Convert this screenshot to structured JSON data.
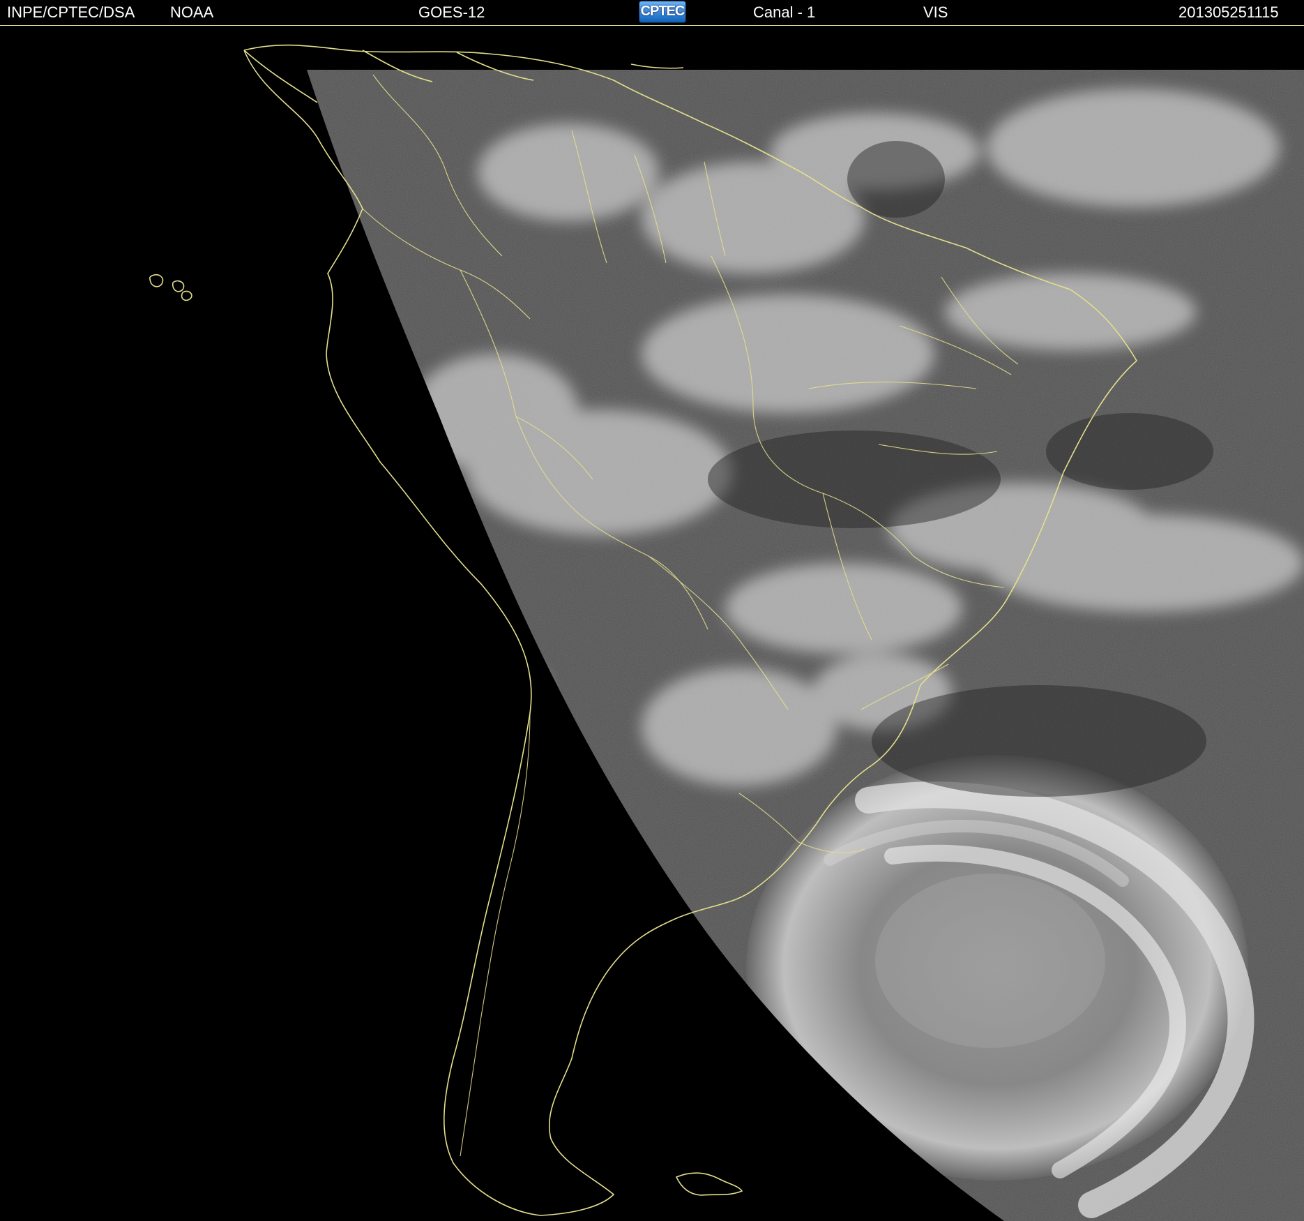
{
  "header": {
    "institution": "INPE/CPTEC/DSA",
    "agency": "NOAA",
    "satellite": "GOES-12",
    "logo_text": "CPTEC",
    "channel": "Canal - 1",
    "band": "VIS",
    "timestamp": "201305251115"
  },
  "colors": {
    "background": "#000000",
    "coastline": "#e4df8c",
    "cloud": "#d7d7d7",
    "ocean_image": "#505050"
  },
  "map": {
    "features": [
      "south-america-coastline",
      "political-borders",
      "cloud-cover",
      "cyclone-swirl"
    ]
  }
}
